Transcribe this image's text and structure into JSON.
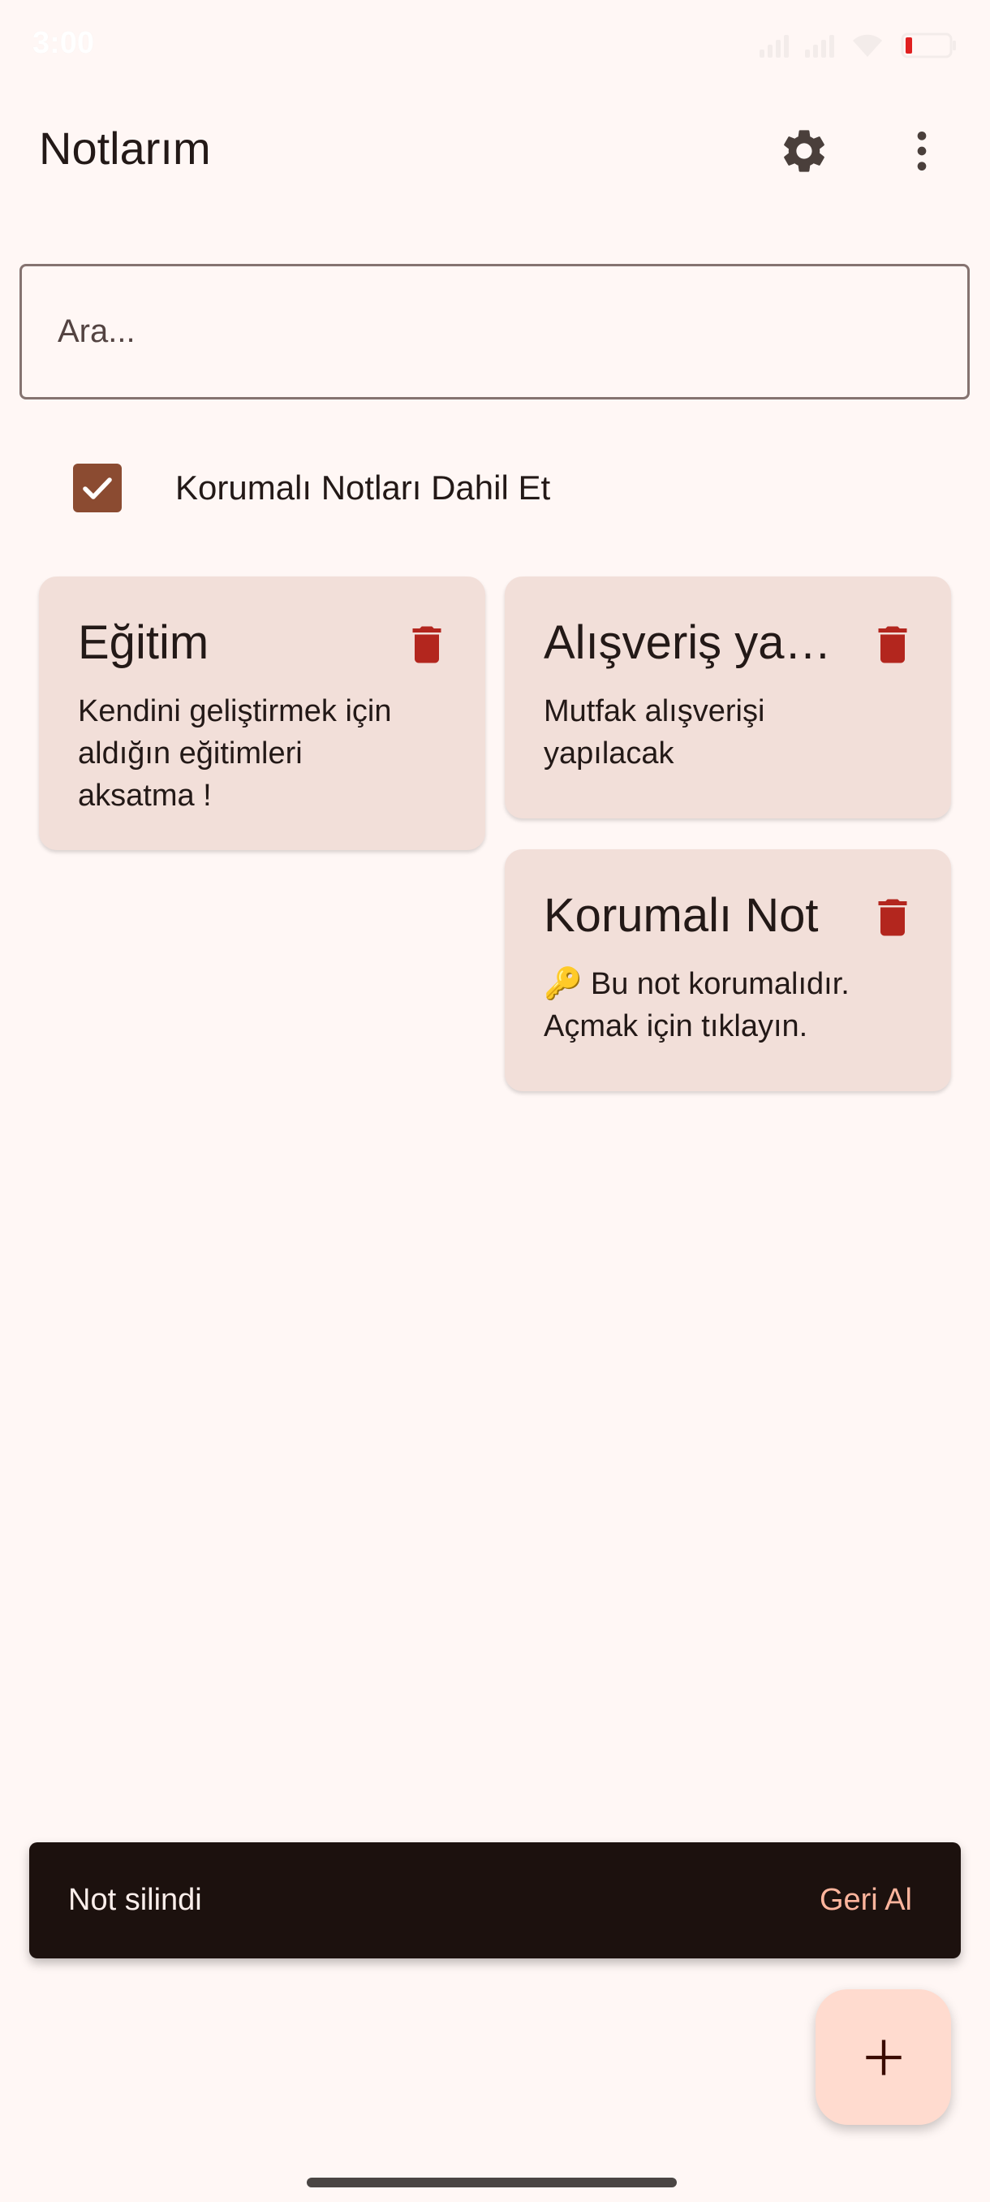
{
  "status_bar": {
    "time": "3:00",
    "icons": [
      "signal-icon",
      "signal-icon",
      "wifi-icon",
      "battery-icon"
    ]
  },
  "app_bar": {
    "title": "Notlarım",
    "settings_icon": "gear-icon",
    "more_icon": "more-vert-icon"
  },
  "search": {
    "placeholder": "Ara..."
  },
  "filter": {
    "include_protected_label": "Korumalı Notları Dahil Et",
    "include_protected_checked": true
  },
  "notes": [
    {
      "title": "Eğitim",
      "body": "Kendini geliştirmek için aldığın eğitimleri aksatma !",
      "delete_icon": "trash-icon"
    },
    {
      "title": "Alışveriş yapılacak",
      "body": "Mutfak alışverişi yapılacak",
      "delete_icon": "trash-icon"
    },
    {
      "title": "Korumalı Not",
      "body": "🔑 Bu not korumalıdır. Açmak için tıklayın.",
      "delete_icon": "trash-icon"
    }
  ],
  "snackbar": {
    "message": "Not silindi",
    "action_label": "Geri Al"
  },
  "fab": {
    "icon": "plus-icon"
  },
  "colors": {
    "background": "#FFF7F5",
    "card": "#F2DFD9",
    "accent": "#8B4B31",
    "delete": "#B3261E",
    "snackbar": "#1C110E",
    "snackbar_action": "#FFB59D",
    "fab": "#FFDBCF"
  }
}
